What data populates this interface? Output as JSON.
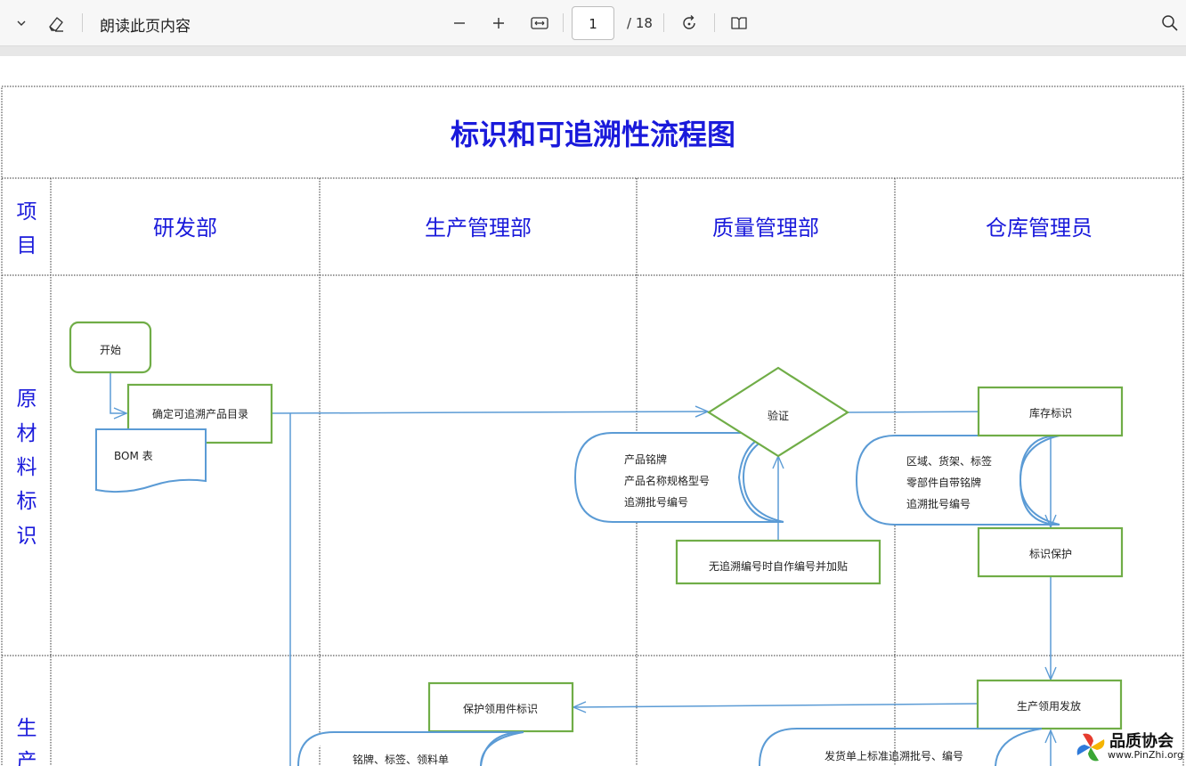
{
  "toolbar": {
    "read_aloud_label": "朗读此页内容",
    "current_page": "1",
    "total_pages": "/ 18"
  },
  "document": {
    "title": "标识和可追溯性流程图",
    "col_item": "项目",
    "columns": [
      "研发部",
      "生产管理部",
      "质量管理部",
      "仓库管理员"
    ],
    "rows": [
      "原材料标识",
      "生产"
    ],
    "flow": {
      "start": "开始",
      "define_list": "确定可追溯产品目录",
      "bom": "BOM 表",
      "verify": "验证",
      "product_info": [
        "产品铭牌",
        "产品名称规格型号",
        "追溯批号编号"
      ],
      "self_number": "无追溯编号时自作编号并加贴",
      "stock_mark": "库存标识",
      "stock_info": [
        "区域、货架、标签",
        "零部件自带铭牌",
        "追溯批号编号"
      ],
      "mark_protect": "标识保护",
      "protect_picked": "保护领用件标识",
      "prod_issue": "生产领用发放",
      "nameplate_tags": "铭牌、标签、领料单",
      "issue_note": "发货单上标准追溯批号、编号"
    }
  },
  "watermark": {
    "name": "品质协会",
    "url": "www.PinZhi.org"
  },
  "colors": {
    "header_blue": "#1a1adb",
    "box_green": "#70ad47",
    "line_blue": "#5b9bd5"
  }
}
